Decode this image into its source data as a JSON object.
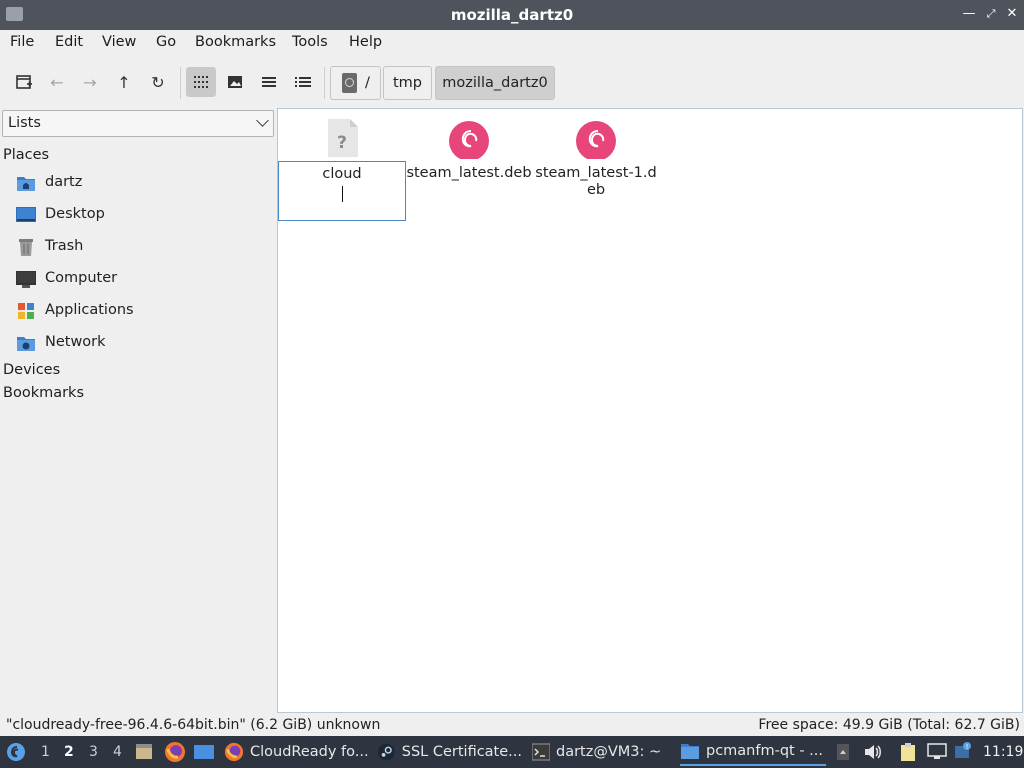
{
  "window": {
    "title": "mozilla_dartz0",
    "controls": [
      "minimize-icon",
      "maximize-icon",
      "close-icon"
    ]
  },
  "menu": [
    "File",
    "Edit",
    "View",
    "Go",
    "Bookmarks",
    "Tools",
    "Help"
  ],
  "toolbar": {
    "buttons": [
      "new-tab-icon",
      "back-icon",
      "forward-icon",
      "up-icon",
      "reload-icon",
      "icon-view-icon",
      "thumbnail-view-icon",
      "compact-view-icon",
      "detailed-list-view-icon"
    ],
    "active_view": "icon-view-icon",
    "path": [
      "/",
      "tmp",
      "mozilla_dartz0"
    ]
  },
  "sidebar": {
    "selector": "Lists",
    "places_label": "Places",
    "places": [
      {
        "label": "dartz",
        "icon": "home-folder-icon"
      },
      {
        "label": "Desktop",
        "icon": "desktop-icon"
      },
      {
        "label": "Trash",
        "icon": "trash-icon"
      },
      {
        "label": "Computer",
        "icon": "computer-icon"
      },
      {
        "label": "Applications",
        "icon": "applications-icon"
      },
      {
        "label": "Network",
        "icon": "network-icon"
      }
    ],
    "devices_label": "Devices",
    "bookmarks_label": "Bookmarks"
  },
  "files": [
    {
      "name": "cloud",
      "icon": "unknown-file-icon",
      "renaming": true
    },
    {
      "name": "steam_latest.deb",
      "icon": "debian-package-icon"
    },
    {
      "name": "steam_latest-1.deb",
      "icon": "debian-package-icon"
    }
  ],
  "status": {
    "left": "\"cloudready-free-96.4.6-64bit.bin\" (6.2 GiB) unknown",
    "right": "Free space: 49.9 GiB (Total: 62.7 GiB)"
  },
  "taskbar": {
    "workspaces": [
      "1",
      "2",
      "3",
      "4"
    ],
    "current_workspace": "2",
    "tasks": [
      {
        "label": "CloudReady fo...",
        "icon": "firefox-icon"
      },
      {
        "label": "SSL Certificate...",
        "icon": "steam-icon"
      },
      {
        "label": "dartz@VM3: ~",
        "icon": "terminal-icon"
      },
      {
        "label": "pcmanfm-qt - ...",
        "icon": "folder-icon"
      }
    ],
    "clock": "11:19"
  },
  "colors": {
    "titlebar": "#4f545c",
    "taskbar": "#2e3440",
    "debian_red": "#e8457a",
    "folder_blue": "#3f7ecf"
  }
}
